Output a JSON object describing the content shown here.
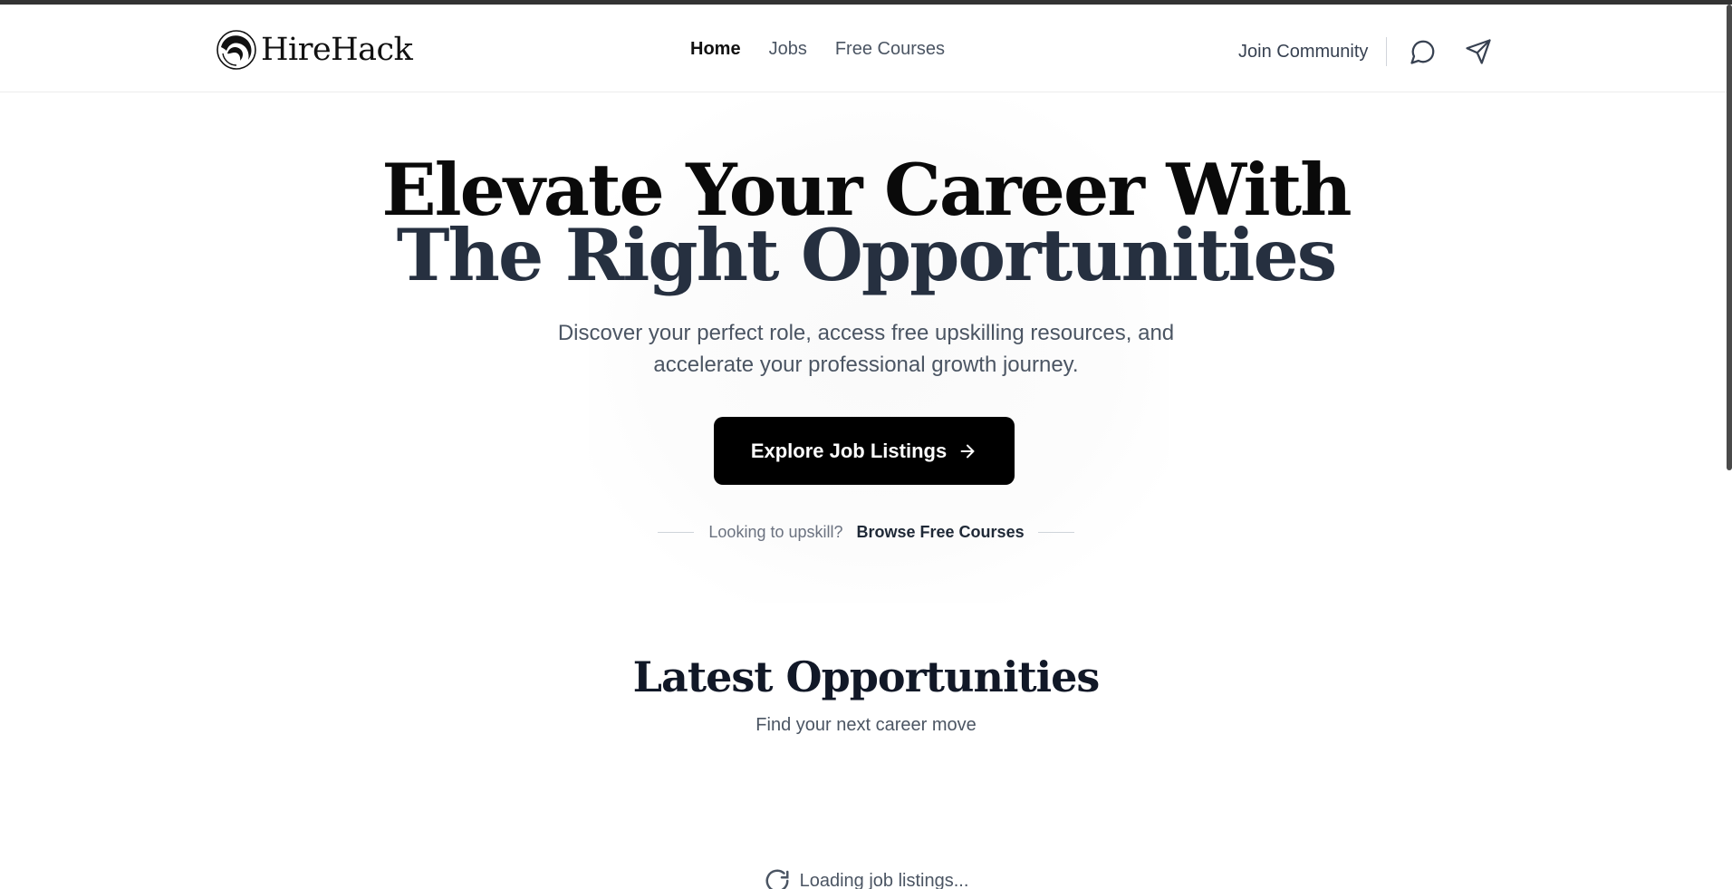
{
  "brand": {
    "name": "HireHack",
    "logo_icon": "hirehack-logo-icon"
  },
  "nav": {
    "links": [
      {
        "label": "Home",
        "active": true
      },
      {
        "label": "Jobs",
        "active": false
      },
      {
        "label": "Free Courses",
        "active": false
      }
    ],
    "community_label": "Join Community",
    "icons": [
      "chat-bubble-icon",
      "send-icon"
    ]
  },
  "hero": {
    "title_line1": "Elevate Your Career With",
    "title_line2": "The Right Opportunities",
    "subtitle_line1": "Discover your perfect role, access free upskilling resources, and",
    "subtitle_line2": "accelerate your professional growth journey.",
    "cta_label": "Explore Job Listings",
    "cta_icon": "arrow-right-icon",
    "upskill_prompt": "Looking to upskill?",
    "upskill_link": "Browse Free Courses"
  },
  "latest": {
    "title": "Latest Opportunities",
    "subtitle": "Find your next career move",
    "loading_text": "Loading job listings...",
    "loading_icon": "loading-spinner-icon"
  },
  "colors": {
    "primary_button": "#000000",
    "title_dark": "#0a0a0a",
    "title_slate": "#263040",
    "muted_text": "#4b5563"
  }
}
